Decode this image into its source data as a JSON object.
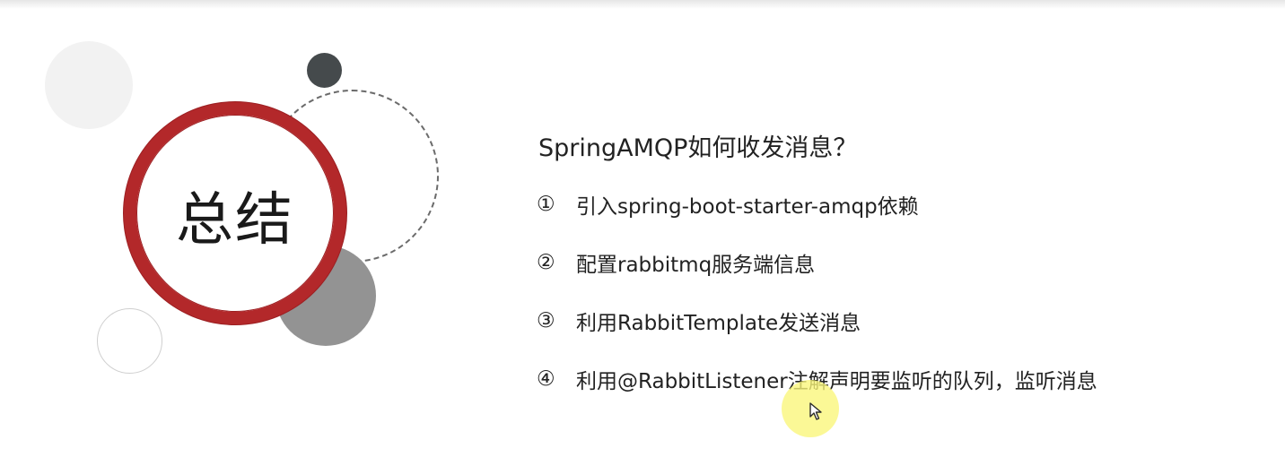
{
  "slide": {
    "summary_title": "总结",
    "question": "SpringAMQP如何收发消息？",
    "items": [
      {
        "num": "①",
        "text": "引入spring-boot-starter-amqp依赖"
      },
      {
        "num": "②",
        "text": "配置rabbitmq服务端信息"
      },
      {
        "num": "③",
        "text": "利用RabbitTemplate发送消息"
      },
      {
        "num": "④",
        "text": "利用@RabbitListener注解声明要监听的队列，监听消息"
      }
    ]
  },
  "colors": {
    "accent_red": "#b3282a",
    "dark_circle": "#454a4c",
    "gray_circle": "#939393",
    "cursor_highlight": "#faf678"
  },
  "icons": {
    "cursor": "mouse-pointer-icon"
  }
}
